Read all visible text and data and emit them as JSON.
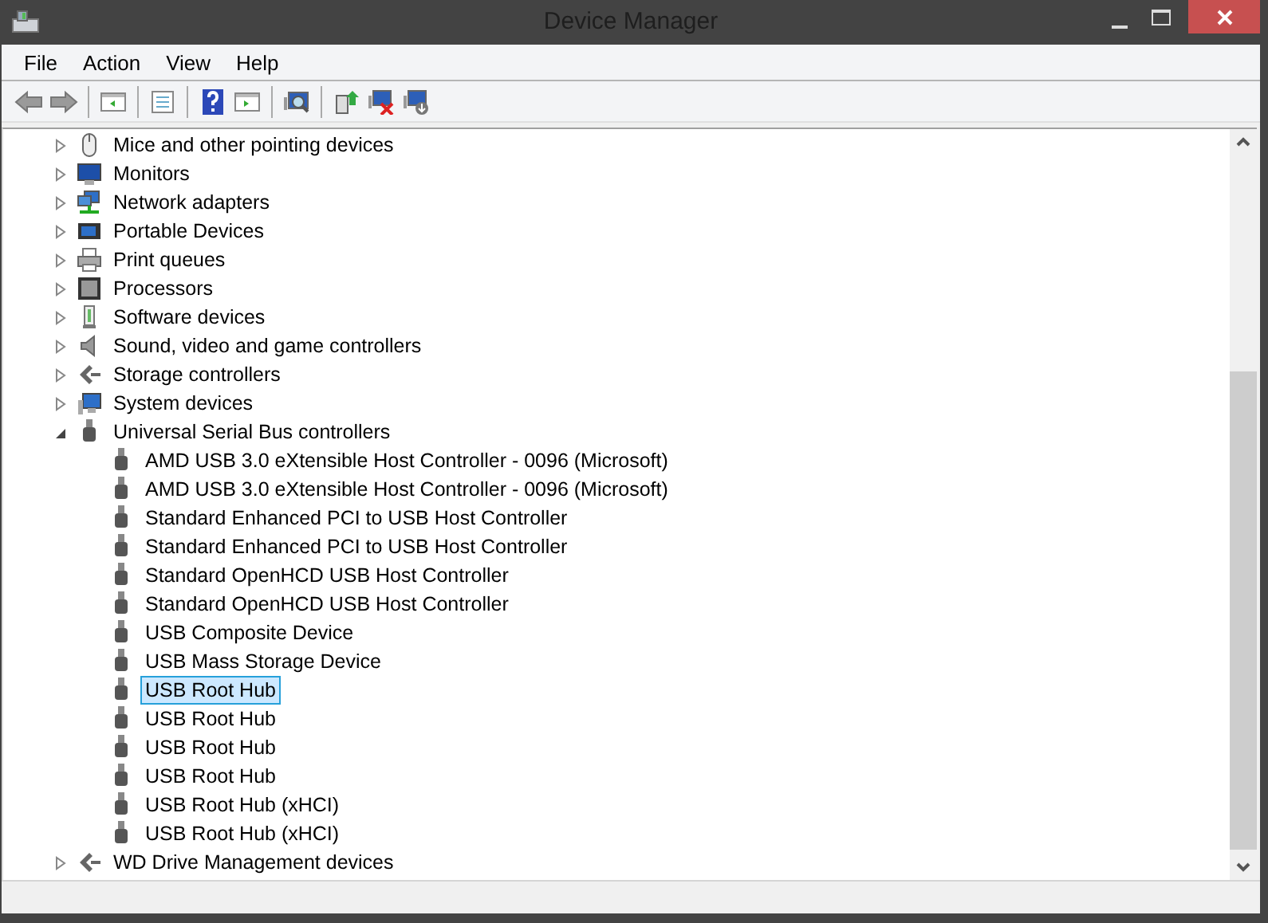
{
  "window": {
    "title": "Device Manager"
  },
  "menu": [
    "File",
    "Action",
    "View",
    "Help"
  ],
  "toolbar": [
    {
      "kind": "back"
    },
    {
      "kind": "forward"
    },
    {
      "kind": "sep"
    },
    {
      "kind": "tree"
    },
    {
      "kind": "sep"
    },
    {
      "kind": "properties"
    },
    {
      "kind": "sep"
    },
    {
      "kind": "help"
    },
    {
      "kind": "pane"
    },
    {
      "kind": "sep"
    },
    {
      "kind": "scan"
    },
    {
      "kind": "sep"
    },
    {
      "kind": "update"
    },
    {
      "kind": "uninstall"
    },
    {
      "kind": "disable"
    }
  ],
  "tree": [
    {
      "label": "Mice and other pointing devices",
      "kind": "mouse",
      "expanded": false
    },
    {
      "label": "Monitors",
      "kind": "monitor",
      "expanded": false
    },
    {
      "label": "Network adapters",
      "kind": "network",
      "expanded": false
    },
    {
      "label": "Portable Devices",
      "kind": "portable",
      "expanded": false
    },
    {
      "label": "Print queues",
      "kind": "printer",
      "expanded": false
    },
    {
      "label": "Processors",
      "kind": "chip",
      "expanded": false
    },
    {
      "label": "Software devices",
      "kind": "software",
      "expanded": false
    },
    {
      "label": "Sound, video and game controllers",
      "kind": "speaker",
      "expanded": false
    },
    {
      "label": "Storage controllers",
      "kind": "storage",
      "expanded": false
    },
    {
      "label": "System devices",
      "kind": "system",
      "expanded": false
    },
    {
      "label": "Universal Serial Bus controllers",
      "kind": "usb",
      "expanded": true,
      "children": [
        {
          "label": "AMD USB 3.0 eXtensible Host Controller - 0096 (Microsoft)",
          "selected": false
        },
        {
          "label": "AMD USB 3.0 eXtensible Host Controller - 0096 (Microsoft)",
          "selected": false
        },
        {
          "label": "Standard Enhanced PCI to USB Host Controller",
          "selected": false
        },
        {
          "label": "Standard Enhanced PCI to USB Host Controller",
          "selected": false
        },
        {
          "label": "Standard OpenHCD USB Host Controller",
          "selected": false
        },
        {
          "label": "Standard OpenHCD USB Host Controller",
          "selected": false
        },
        {
          "label": "USB Composite Device",
          "selected": false
        },
        {
          "label": "USB Mass Storage Device",
          "selected": false
        },
        {
          "label": "USB Root Hub",
          "selected": true
        },
        {
          "label": "USB Root Hub",
          "selected": false
        },
        {
          "label": "USB Root Hub",
          "selected": false
        },
        {
          "label": "USB Root Hub",
          "selected": false
        },
        {
          "label": "USB Root Hub (xHCI)",
          "selected": false
        },
        {
          "label": "USB Root Hub (xHCI)",
          "selected": false
        }
      ]
    },
    {
      "label": "WD Drive Management devices",
      "kind": "storage",
      "expanded": false
    }
  ]
}
